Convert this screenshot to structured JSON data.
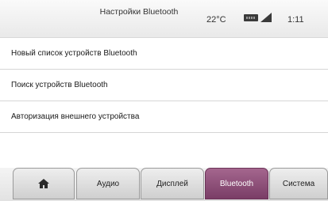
{
  "header": {
    "title": "Настройки Bluetooth",
    "temperature": "22°C",
    "battery_icon": "battery-icon",
    "signal_icon": "signal-icon",
    "time": "1:11"
  },
  "menu": {
    "items": [
      {
        "label": "Новый список устройств Bluetooth"
      },
      {
        "label": "Поиск устройств Bluetooth"
      },
      {
        "label": "Авторизация внешнего устройства"
      },
      {
        "label": ""
      }
    ]
  },
  "tabs": {
    "home_icon": "home-icon",
    "items": [
      {
        "label": "Аудио"
      },
      {
        "label": "Дисплей"
      },
      {
        "label": "Bluetooth"
      },
      {
        "label": "Система"
      }
    ],
    "active": "Bluetooth",
    "active_color": "#8e4f7a"
  }
}
